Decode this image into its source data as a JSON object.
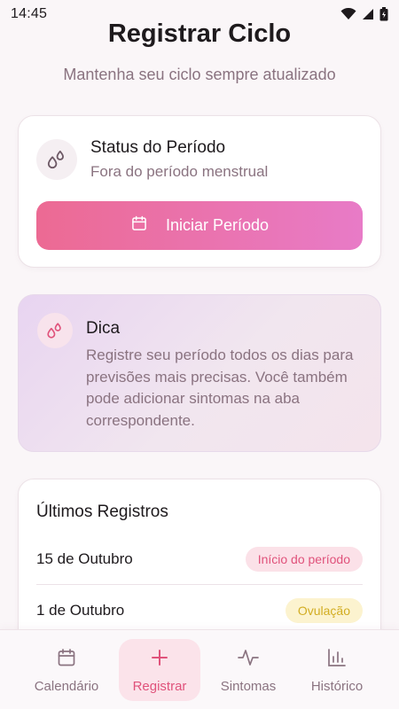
{
  "status_bar": {
    "time": "14:45",
    "icons": [
      "wifi-icon",
      "signal-icon",
      "battery-icon"
    ]
  },
  "header": {
    "title": "Registrar Ciclo",
    "subtitle": "Mantenha seu ciclo sempre atualizado"
  },
  "period_status": {
    "icon": "drops-icon",
    "title": "Status do Período",
    "status": "Fora do período menstrual",
    "button_label": "Iniciar Período",
    "button_icon": "calendar-icon"
  },
  "tip": {
    "icon": "drops-icon",
    "title": "Dica",
    "text": "Registre seu período todos os dias para previsões mais precisas. Você também pode adicionar sintomas na aba correspondente."
  },
  "recent_records": {
    "title": "Últimos Registros",
    "items": [
      {
        "date": "15 de Outubro",
        "badge": "Início do período"
      },
      {
        "date": "1 de Outubro",
        "badge": "Ovulação"
      }
    ]
  },
  "bottom_nav": {
    "items": [
      {
        "label": "Calendário",
        "icon": "calendar-icon",
        "active": false
      },
      {
        "label": "Registrar",
        "icon": "plus-icon",
        "active": true
      },
      {
        "label": "Sintomas",
        "icon": "pulse-icon",
        "active": false
      },
      {
        "label": "Histórico",
        "icon": "bar-chart-icon",
        "active": false
      }
    ]
  },
  "colors": {
    "accent": "#e0527b",
    "button_gradient_start": "#ec6a93",
    "button_gradient_end": "#e87bc7",
    "muted_text": "#8a7380",
    "ovulation_badge": "#d2ad22"
  }
}
